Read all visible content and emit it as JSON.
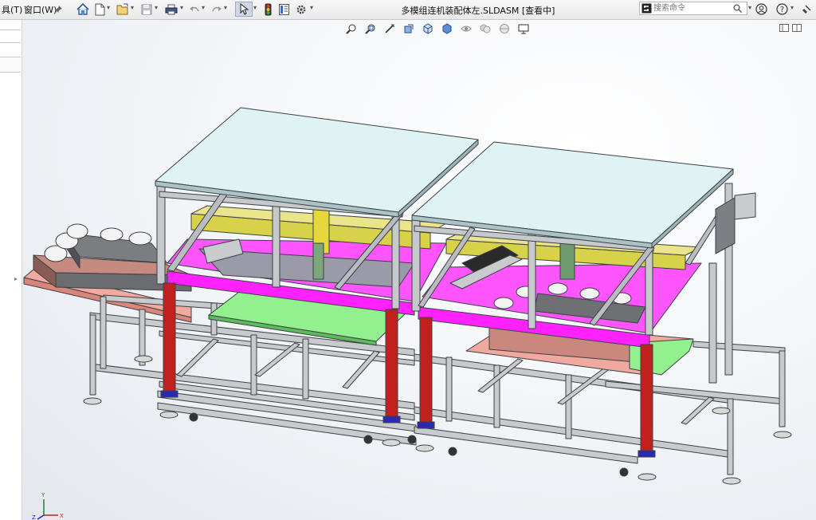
{
  "menu": {
    "tools_label": "具(T)",
    "window_label": "窗口(W)"
  },
  "toolbar": {
    "icons": [
      "pin-icon",
      "home-icon",
      "new-file-icon",
      "open-file-icon",
      "save-icon",
      "print-icon",
      "undo-icon",
      "redo-icon",
      "select-pointer-icon",
      "traffic-light-icon",
      "file-properties-icon",
      "options-gear-icon"
    ]
  },
  "document": {
    "title": "多模组连机装配体左.SLDASM [查看中]"
  },
  "search": {
    "placeholder": "搜索命令"
  },
  "headsup_toolbar": {
    "icons": [
      "zoom-fit-icon",
      "zoom-area-icon",
      "previous-view-icon",
      "section-view-icon",
      "view-orientation-icon",
      "display-style-icon",
      "hide-show-icon",
      "appearance-icon",
      "scene-icon",
      "display-settings-icon"
    ]
  },
  "colors": {
    "frame": "#c6c9cc",
    "frame_edge": "#55585c",
    "top_glass": "#dff3f5",
    "magenta": "#ff00ff",
    "yellow_rail": "#d8d24a",
    "green_plate": "#8ef08c",
    "salmon": "#f0aaa0",
    "red_post": "#c21f1f",
    "blue_foot": "#2a2ab0"
  },
  "triad": {
    "x_label": "X",
    "y_label": "Y",
    "z_label": "Z"
  }
}
